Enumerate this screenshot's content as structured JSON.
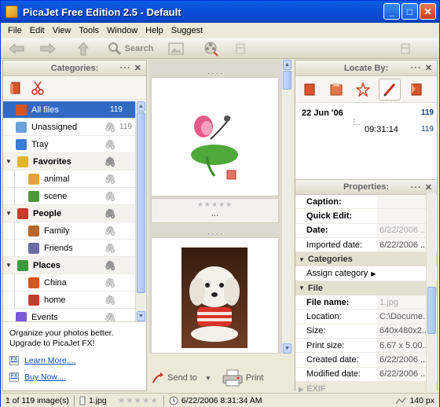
{
  "window": {
    "title": "PicaJet Free Edition 2.5  - Default",
    "minimize": "_",
    "maximize": "□",
    "close": "✕"
  },
  "menu": [
    "File",
    "Edit",
    "View",
    "Tools",
    "Window",
    "Help",
    "Suggest"
  ],
  "toolbar": {
    "search_label": "Search"
  },
  "categories": {
    "title": "Categories:",
    "items": [
      {
        "label": "All files",
        "count": "119",
        "icon": "house-icon",
        "color": "#d9531e",
        "selected": true
      },
      {
        "label": "Unassigned",
        "count": "119",
        "icon": "cube-icon",
        "color": "#6aa0d8"
      },
      {
        "label": "Tray",
        "count": "",
        "icon": "tray-icon",
        "color": "#3a7bd5"
      },
      {
        "label": "Favorites",
        "group": true,
        "icon": "star-icon",
        "color": "#e4b42a"
      },
      {
        "label": "animal",
        "child": true,
        "icon": "butterfly-icon",
        "color": "#e4a23a"
      },
      {
        "label": "scene",
        "child": true,
        "icon": "palm-icon",
        "color": "#4a9a3a"
      },
      {
        "label": "People",
        "group": true,
        "icon": "people-icon",
        "color": "#c83a2a"
      },
      {
        "label": "Family",
        "child": true,
        "icon": "person-icon",
        "color": "#b8652a"
      },
      {
        "label": "Friends",
        "child": true,
        "icon": "friends-icon",
        "color": "#6a6aa8"
      },
      {
        "label": "Places",
        "group": true,
        "icon": "places-icon",
        "color": "#3a9a3a"
      },
      {
        "label": "China",
        "child": true,
        "icon": "house-icon",
        "color": "#d9531e"
      },
      {
        "label": "home",
        "child": true,
        "icon": "home-people-icon",
        "color": "#c83a2a"
      },
      {
        "label": "Events",
        "icon": "events-icon",
        "color": "#7a5ad8"
      }
    ]
  },
  "promo": {
    "text": "Organize your photos better. Upgrade to PicaJet FX!",
    "learn_more": "Learn More....",
    "buy_now": "Buy Now...."
  },
  "thumbnails": {
    "stars": "★★★★★",
    "ellipsis": "..."
  },
  "bottom_actions": {
    "send_to": "Send to",
    "print": "Print"
  },
  "locate": {
    "title": "Locate By:",
    "date": "22 Jun  '06",
    "date_count": "119",
    "time": "09:31:14",
    "time_count": "119"
  },
  "properties": {
    "title": "Properties:",
    "rows": [
      {
        "key": "Caption:",
        "value": "",
        "bold": true
      },
      {
        "key": "Quick Edit:",
        "value": "",
        "bold": true
      },
      {
        "key": "Date:",
        "value": "6/22/2006 ...",
        "bold": true,
        "grey": true
      },
      {
        "key": "Imported date:",
        "value": "6/22/2006 ...",
        "bold": false
      }
    ],
    "categories_section": "Categories",
    "assign": "Assign category",
    "file_section": "File",
    "file_rows": [
      {
        "key": "File name:",
        "value": "1.jpg",
        "bold": true,
        "grey": true
      },
      {
        "key": "Location:",
        "value": "C:\\Docume..."
      },
      {
        "key": "Size:",
        "value": "640x480x2..."
      },
      {
        "key": "Print size:",
        "value": "6.67 x 5.00..."
      },
      {
        "key": "Created date:",
        "value": "6/22/2006 ..."
      },
      {
        "key": "Modified date:",
        "value": "6/22/2006 ..."
      }
    ],
    "exif_section": "EXIF"
  },
  "status": {
    "count": "1 of 119 image(s)",
    "file": "1.jpg",
    "stars": "★★★★★",
    "datetime": "6/22/2006 8:31:34 AM",
    "zoom": "140 px"
  }
}
